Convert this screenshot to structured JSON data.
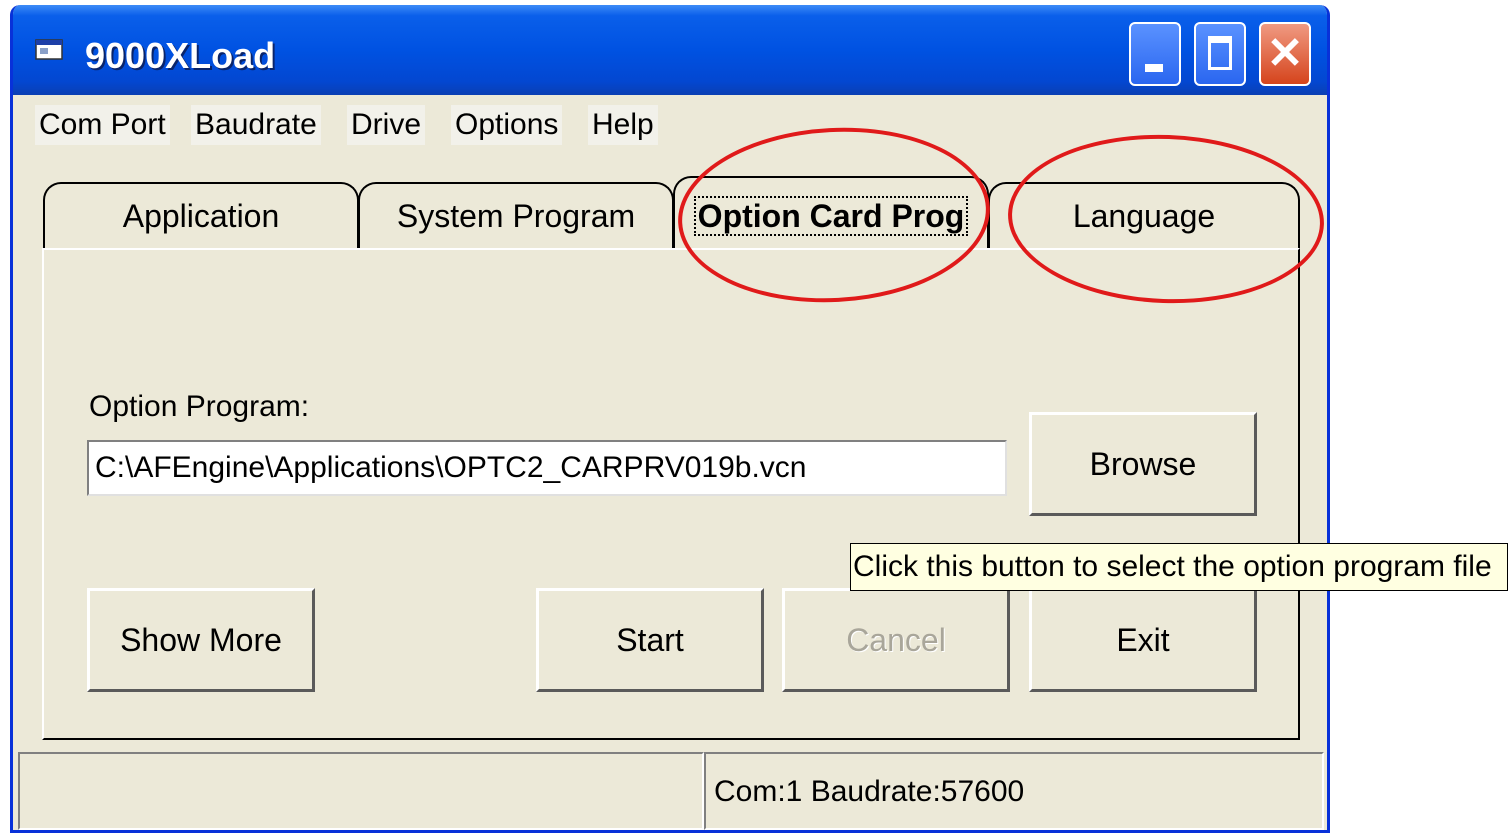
{
  "window": {
    "title": "9000XLoad"
  },
  "menu": [
    "Com Port",
    "Baudrate",
    "Drive",
    "Options",
    "Help"
  ],
  "tabs": [
    {
      "label": "Application",
      "active": false
    },
    {
      "label": "System Program",
      "active": false
    },
    {
      "label": "Option Card Prog",
      "active": true
    },
    {
      "label": "Language",
      "active": false
    }
  ],
  "option_program": {
    "label": "Option Program:",
    "value": "C:\\AFEngine\\Applications\\OPTC2_CARPRV019b.vcn"
  },
  "buttons": {
    "browse": "Browse",
    "show_more": "Show More",
    "start": "Start",
    "cancel": "Cancel",
    "exit": "Exit"
  },
  "tooltip": "Click this button to select the option program file",
  "status": {
    "left": "",
    "right": "Com:1  Baudrate:57600"
  },
  "colors": {
    "title_bar": "#0052e2",
    "window_bg": "#ece9d8",
    "highlight_circle": "#e01a1a",
    "tooltip_bg": "#ffffe1"
  },
  "icons": {
    "app": "app-window-icon",
    "minimize": "minimize-icon",
    "maximize": "maximize-icon",
    "close": "close-icon"
  }
}
